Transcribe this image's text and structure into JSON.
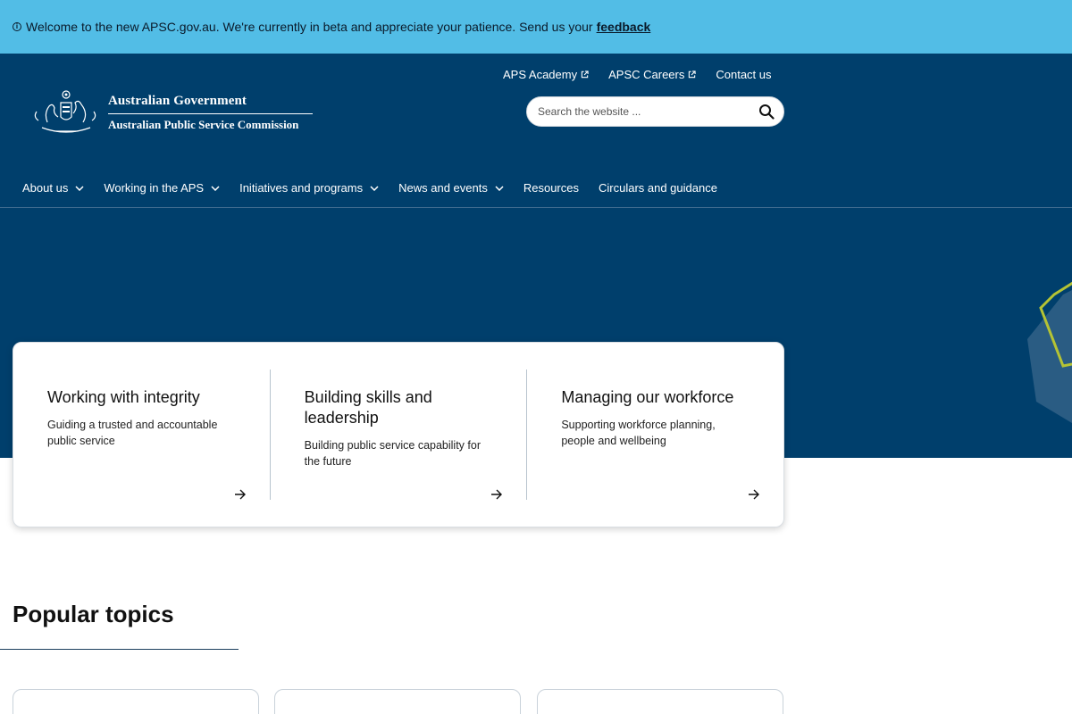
{
  "banner": {
    "message": "Welcome to the new APSC.gov.au. We're currently in beta and appreciate your patience. Send us your",
    "link_label": "feedback"
  },
  "logo": {
    "line1": "Australian Government",
    "line2": "Australian Public Service Commission"
  },
  "top_links": [
    {
      "label": "APS Academy",
      "external": true
    },
    {
      "label": "APSC Careers",
      "external": true
    },
    {
      "label": "Contact us",
      "external": false
    }
  ],
  "search": {
    "placeholder": "Search the website ..."
  },
  "nav": [
    {
      "label": "About us",
      "has_dropdown": true
    },
    {
      "label": "Working in the APS",
      "has_dropdown": true
    },
    {
      "label": "Initiatives and programs",
      "has_dropdown": true
    },
    {
      "label": "News and events",
      "has_dropdown": true
    },
    {
      "label": "Resources",
      "has_dropdown": false
    },
    {
      "label": "Circulars and guidance",
      "has_dropdown": false
    }
  ],
  "features": [
    {
      "title": "Working with integrity",
      "description": "Guiding a trusted and accountable public service"
    },
    {
      "title": "Building skills and leadership",
      "description": "Building public service capability for the future"
    },
    {
      "title": "Managing our workforce",
      "description": "Supporting workforce planning, people and wellbeing"
    }
  ],
  "popular": {
    "title": "Popular topics"
  },
  "colors": {
    "banner_bg": "#52bde6",
    "header_bg": "#003f6c",
    "accent_hex": "#b5c334"
  }
}
